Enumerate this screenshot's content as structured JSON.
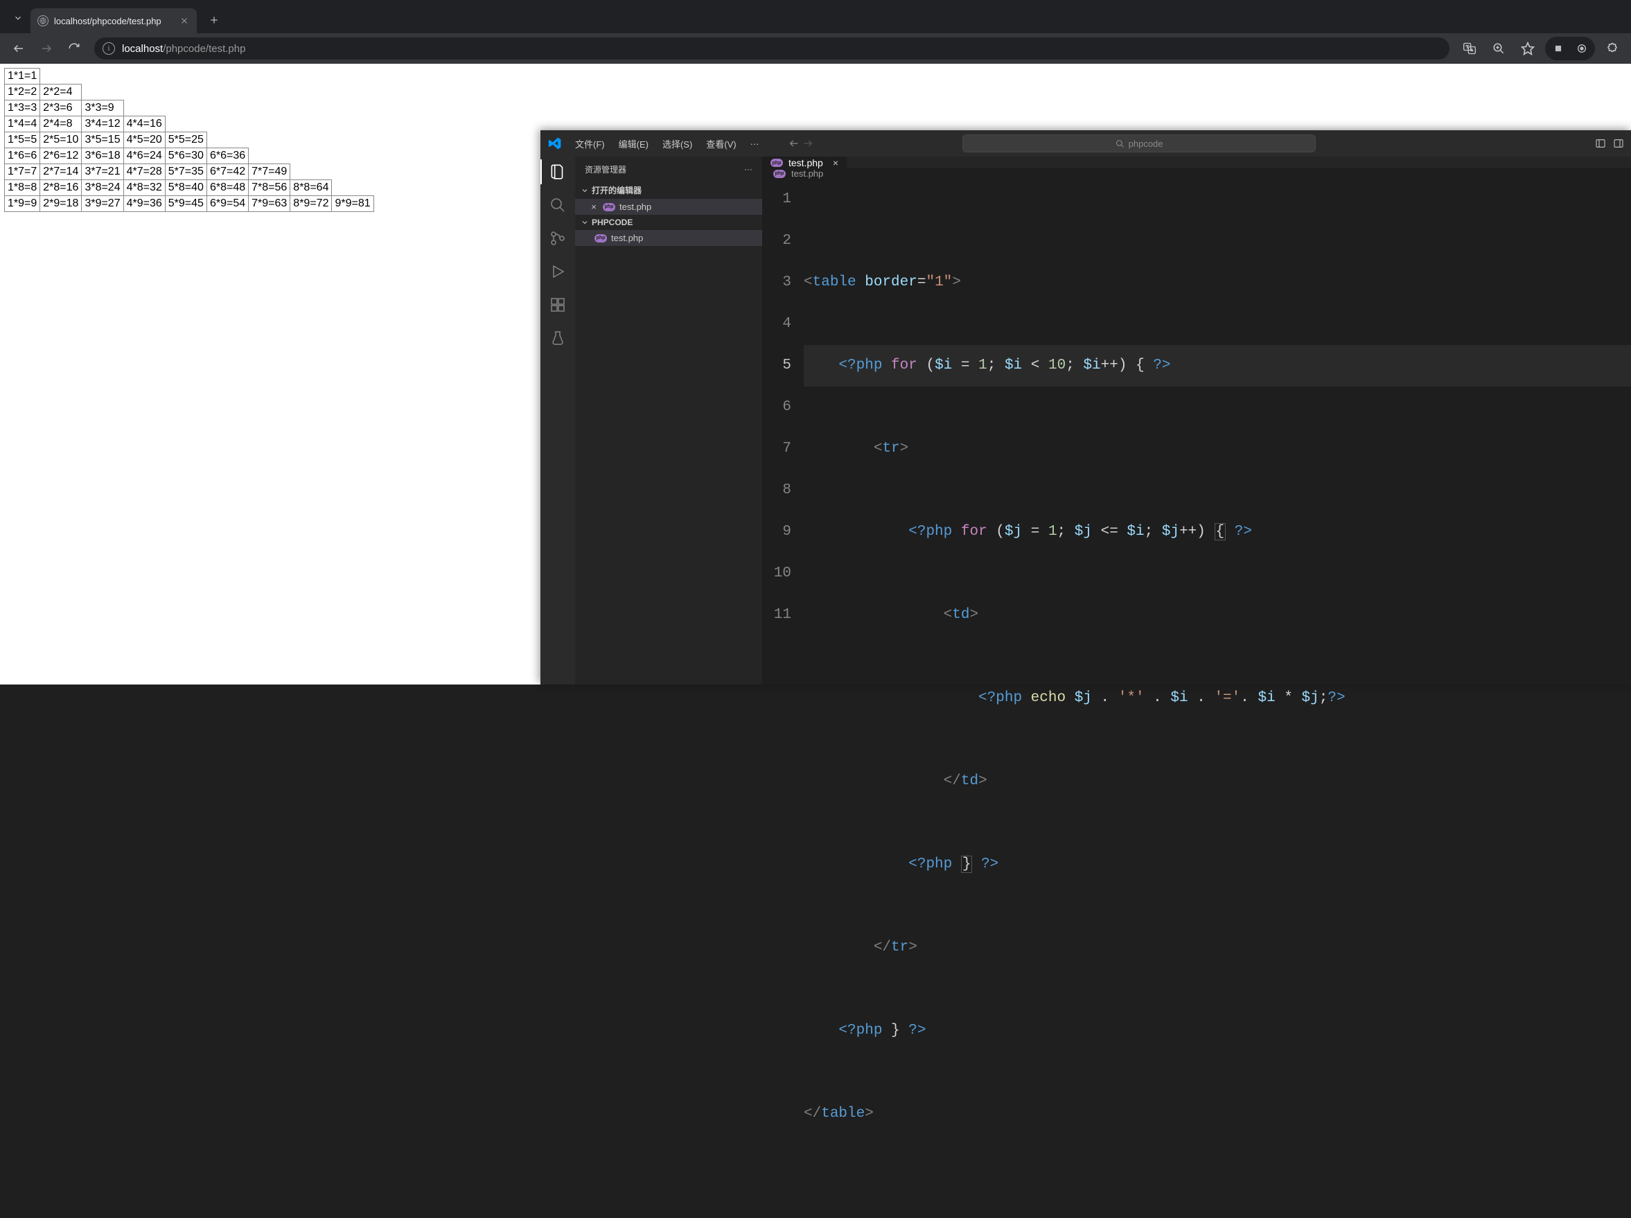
{
  "browser": {
    "tab_title": "localhost/phpcode/test.php",
    "url_host": "localhost",
    "url_path": "/phpcode/test.php"
  },
  "mult_table": [
    [
      "1*1=1"
    ],
    [
      "1*2=2",
      "2*2=4"
    ],
    [
      "1*3=3",
      "2*3=6",
      "3*3=9"
    ],
    [
      "1*4=4",
      "2*4=8",
      "3*4=12",
      "4*4=16"
    ],
    [
      "1*5=5",
      "2*5=10",
      "3*5=15",
      "4*5=20",
      "5*5=25"
    ],
    [
      "1*6=6",
      "2*6=12",
      "3*6=18",
      "4*6=24",
      "5*6=30",
      "6*6=36"
    ],
    [
      "1*7=7",
      "2*7=14",
      "3*7=21",
      "4*7=28",
      "5*7=35",
      "6*7=42",
      "7*7=49"
    ],
    [
      "1*8=8",
      "2*8=16",
      "3*8=24",
      "4*8=32",
      "5*8=40",
      "6*8=48",
      "7*8=56",
      "8*8=64"
    ],
    [
      "1*9=9",
      "2*9=18",
      "3*9=27",
      "4*9=36",
      "5*9=45",
      "6*9=54",
      "7*9=63",
      "8*9=72",
      "9*9=81"
    ]
  ],
  "vscode": {
    "menus": {
      "file": "文件(F)",
      "edit": "编辑(E)",
      "select": "选择(S)",
      "view": "查看(V)"
    },
    "search_placeholder": "phpcode",
    "explorer": {
      "title": "资源管理器",
      "open_editors": "打开的编辑器",
      "open_file": "test.php",
      "project": "PHPCODE",
      "project_file": "test.php"
    },
    "tab": {
      "name": "test.php"
    },
    "breadcrumb": "test.php",
    "line_numbers": [
      "1",
      "2",
      "3",
      "4",
      "5",
      "6",
      "7",
      "8",
      "9",
      "10",
      "11"
    ],
    "code": {
      "l1": {
        "open": "<",
        "tag": "table",
        "sp": " ",
        "attr": "border",
        "eq": "=",
        "val": "\"1\"",
        "close": ">"
      },
      "l2": {
        "php_open": "<?php",
        "sp1": " ",
        "kw": "for",
        "sp2": " ",
        "lp": "(",
        "v1": "$i",
        "sp3": " ",
        "eq": "=",
        "sp4": " ",
        "n1": "1",
        "sc1": ";",
        "sp5": " ",
        "v2": "$i",
        "sp6": " ",
        "lt": "<",
        "sp7": " ",
        "n2": "10",
        "sc2": ";",
        "sp8": " ",
        "v3": "$i",
        "inc": "++",
        "rp": ")",
        "sp9": " ",
        "lb": "{",
        "sp10": " ",
        "php_close": "?>"
      },
      "l3": {
        "open": "<",
        "tag": "tr",
        "close": ">"
      },
      "l4": {
        "php_open": "<?php",
        "sp1": " ",
        "kw": "for",
        "sp2": " ",
        "lp": "(",
        "v1": "$j",
        "sp3": " ",
        "eq": "=",
        "sp4": " ",
        "n1": "1",
        "sc1": ";",
        "sp5": " ",
        "v2": "$j",
        "sp6": " ",
        "lte": "<=",
        "sp7": " ",
        "v3": "$i",
        "sc2": ";",
        "sp8": " ",
        "v4": "$j",
        "inc": "++",
        "rp": ")",
        "sp9": " ",
        "lb": "{",
        "sp10": " ",
        "php_close": "?>"
      },
      "l5": {
        "open": "<",
        "tag": "td",
        "close": ">"
      },
      "l6": {
        "php_open": "<?php",
        "sp1": " ",
        "echo": "echo",
        "sp2": " ",
        "v1": "$j",
        "sp3": " ",
        "d1": ".",
        "sp4": " ",
        "s1": "'*'",
        "sp5": " ",
        "d2": ".",
        "sp6": " ",
        "v2": "$i",
        "sp7": " ",
        "d3": ".",
        "sp8": " ",
        "s2": "'='",
        "d4": ".",
        "sp9": " ",
        "v3": "$i",
        "sp10": " ",
        "mul": "*",
        "sp11": " ",
        "v4": "$j",
        "sc": ";",
        "php_close": "?>"
      },
      "l7": {
        "open": "</",
        "tag": "td",
        "close": ">"
      },
      "l8": {
        "php_open": "<?php",
        "sp1": " ",
        "rb": "}",
        "sp2": " ",
        "php_close": "?>"
      },
      "l9": {
        "open": "</",
        "tag": "tr",
        "close": ">"
      },
      "l10": {
        "php_open": "<?php",
        "sp1": " ",
        "rb": "}",
        "sp2": " ",
        "php_close": "?>"
      },
      "l11": {
        "open": "</",
        "tag": "table",
        "close": ">"
      }
    }
  }
}
